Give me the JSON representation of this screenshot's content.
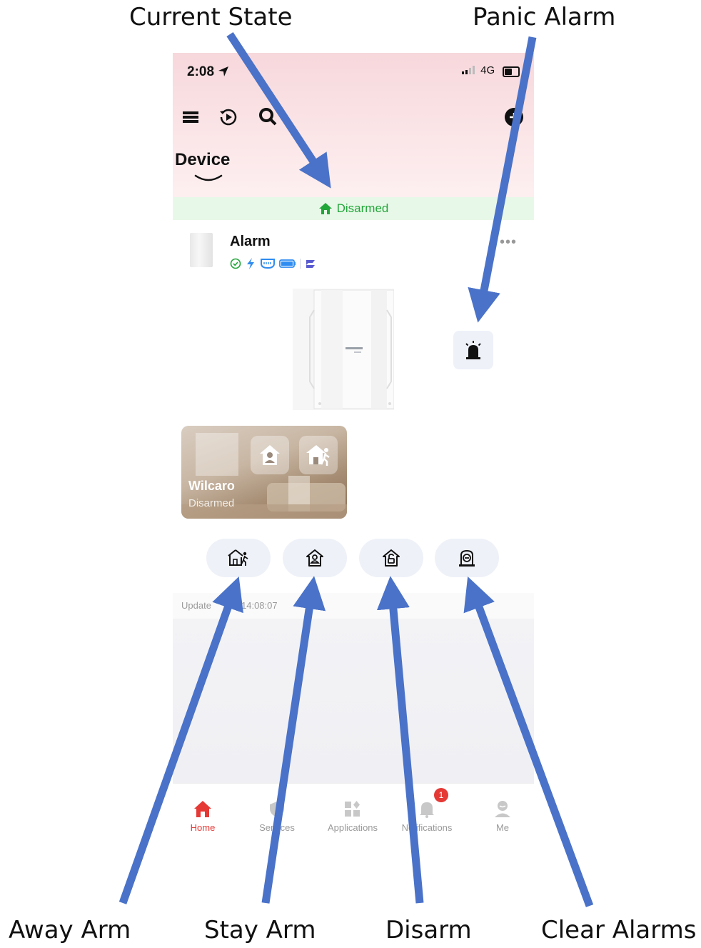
{
  "annotations": {
    "current_state": "Current State",
    "panic_alarm": "Panic Alarm",
    "away_arm": "Away Arm",
    "stay_arm": "Stay Arm",
    "disarm": "Disarm",
    "clear_alarms": "Clear Alarms"
  },
  "annotation_color": "#4a72c8",
  "status_bar": {
    "time": "2:08",
    "network": "4G"
  },
  "toolbar": {
    "icons": [
      "list-icon",
      "playback-icon",
      "search-icon",
      "add-icon"
    ]
  },
  "page_title": "Device",
  "state_bar": {
    "text": "Disarmed",
    "color": "#22a63a"
  },
  "device": {
    "name": "Alarm",
    "status_icons": [
      "online-check-icon",
      "power-icon",
      "network-icon",
      "battery-icon",
      "cloud-icon"
    ],
    "more": "•••"
  },
  "room": {
    "name": "Wilcaro",
    "state": "Disarmed"
  },
  "update": {
    "prefix": "Update",
    "time": "14:08:07"
  },
  "tabs": [
    {
      "label": "Home",
      "icon": "home-icon",
      "active": true
    },
    {
      "label": "Services",
      "icon": "services-icon",
      "active": false
    },
    {
      "label": "Applications",
      "icon": "applications-icon",
      "active": false
    },
    {
      "label": "Notifications",
      "icon": "bell-icon",
      "active": false,
      "badge": "1"
    },
    {
      "label": "Me",
      "icon": "profile-icon",
      "active": false
    }
  ]
}
